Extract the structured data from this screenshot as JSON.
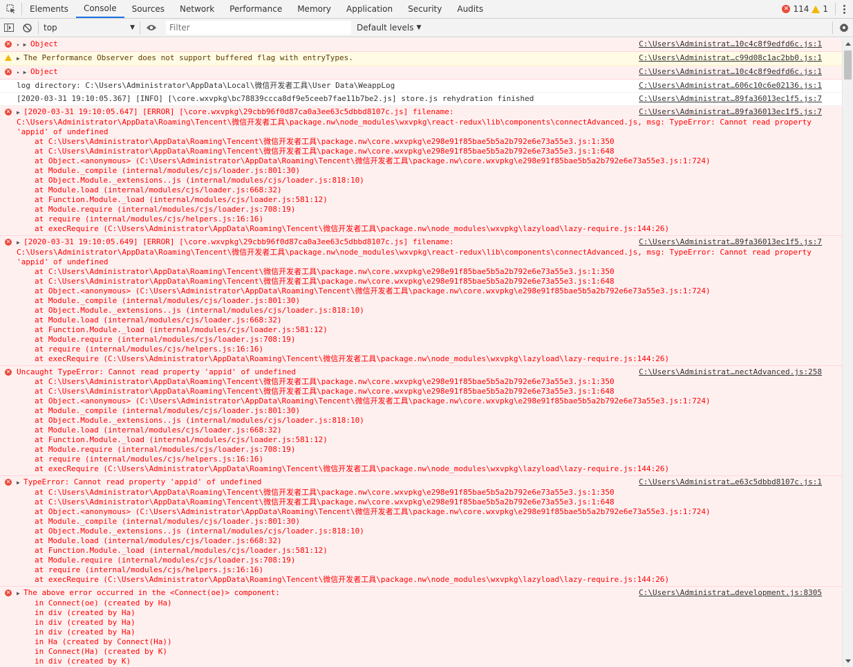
{
  "tabs": [
    "Elements",
    "Console",
    "Sources",
    "Network",
    "Performance",
    "Memory",
    "Application",
    "Security",
    "Audits"
  ],
  "active_tab": "Console",
  "counts": {
    "errors": "114",
    "warnings": "1"
  },
  "toolbar": {
    "context": "top",
    "filter_placeholder": "Filter",
    "levels": "Default levels"
  },
  "messages": [
    {
      "level": "error",
      "expander": "▸ ▶",
      "lines": [
        "Object"
      ],
      "source": "C:\\Users\\Administrat…10c4c8f9edfd6c.js:1"
    },
    {
      "level": "warning",
      "expander": "▶",
      "lines": [
        "The Performance Observer does not support buffered flag with entryTypes."
      ],
      "source": "C:\\Users\\Administrat…c99d08c1ac2bb0.js:1"
    },
    {
      "level": "error",
      "expander": "▸ ▶",
      "lines": [
        "Object"
      ],
      "source": "C:\\Users\\Administrat…10c4c8f9edfd6c.js:1"
    },
    {
      "level": "log",
      "expander": "",
      "lines": [
        "log directory: C:\\Users\\Administrator\\AppData\\Local\\微信开发者工具\\User Data\\WeappLog"
      ],
      "source": "C:\\Users\\Administrat…606c10c6e02136.js:1"
    },
    {
      "level": "log",
      "expander": "",
      "lines": [
        "[2020-03-31 19:10:05.367] [INFO] [\\core.wxvpkg\\bc78839ccca8df9e5ceeb7fae11b7be2.js] store.js rehydration finished"
      ],
      "source": "C:\\Users\\Administrat…89fa36013ec1f5.js:7"
    },
    {
      "level": "error",
      "expander": "▶",
      "lines": [
        "[2020-03-31 19:10:05.647] [ERROR] [\\core.wxvpkg\\29cbb96f0d87ca0a3ee63c5dbbd8107c.js] filename:",
        "C:\\Users\\Administrator\\AppData\\Roaming\\Tencent\\微信开发者工具\\package.nw\\node_modules\\wxvpkg\\react-redux\\lib\\components\\connectAdvanced.js, msg: TypeError: Cannot read property",
        "'appid' of undefined"
      ],
      "stack": [
        "at C:\\Users\\Administrator\\AppData\\Roaming\\Tencent\\微信开发者工具\\package.nw\\core.wxvpkg\\e298e91f85bae5b5a2b792e6e73a55e3.js:1:350",
        "at C:\\Users\\Administrator\\AppData\\Roaming\\Tencent\\微信开发者工具\\package.nw\\core.wxvpkg\\e298e91f85bae5b5a2b792e6e73a55e3.js:1:648",
        "at Object.<anonymous> (C:\\Users\\Administrator\\AppData\\Roaming\\Tencent\\微信开发者工具\\package.nw\\core.wxvpkg\\e298e91f85bae5b5a2b792e6e73a55e3.js:1:724)",
        "at Module._compile (internal/modules/cjs/loader.js:801:30)",
        "at Object.Module._extensions..js (internal/modules/cjs/loader.js:818:10)",
        "at Module.load (internal/modules/cjs/loader.js:668:32)",
        "at Function.Module._load (internal/modules/cjs/loader.js:581:12)",
        "at Module.require (internal/modules/cjs/loader.js:708:19)",
        "at require (internal/modules/cjs/helpers.js:16:16)",
        "at execRequire (C:\\Users\\Administrator\\AppData\\Roaming\\Tencent\\微信开发者工具\\package.nw\\node_modules\\wxvpkg\\lazyload\\lazy-require.js:144:26)"
      ],
      "source": "C:\\Users\\Administrat…89fa36013ec1f5.js:7"
    },
    {
      "level": "error",
      "expander": "▶",
      "lines": [
        "[2020-03-31 19:10:05.649] [ERROR] [\\core.wxvpkg\\29cbb96f0d87ca0a3ee63c5dbbd8107c.js] filename:",
        "C:\\Users\\Administrator\\AppData\\Roaming\\Tencent\\微信开发者工具\\package.nw\\node_modules\\wxvpkg\\react-redux\\lib\\components\\connectAdvanced.js, msg: TypeError: Cannot read property",
        "'appid' of undefined"
      ],
      "stack": [
        "at C:\\Users\\Administrator\\AppData\\Roaming\\Tencent\\微信开发者工具\\package.nw\\core.wxvpkg\\e298e91f85bae5b5a2b792e6e73a55e3.js:1:350",
        "at C:\\Users\\Administrator\\AppData\\Roaming\\Tencent\\微信开发者工具\\package.nw\\core.wxvpkg\\e298e91f85bae5b5a2b792e6e73a55e3.js:1:648",
        "at Object.<anonymous> (C:\\Users\\Administrator\\AppData\\Roaming\\Tencent\\微信开发者工具\\package.nw\\core.wxvpkg\\e298e91f85bae5b5a2b792e6e73a55e3.js:1:724)",
        "at Module._compile (internal/modules/cjs/loader.js:801:30)",
        "at Object.Module._extensions..js (internal/modules/cjs/loader.js:818:10)",
        "at Module.load (internal/modules/cjs/loader.js:668:32)",
        "at Function.Module._load (internal/modules/cjs/loader.js:581:12)",
        "at Module.require (internal/modules/cjs/loader.js:708:19)",
        "at require (internal/modules/cjs/helpers.js:16:16)",
        "at execRequire (C:\\Users\\Administrator\\AppData\\Roaming\\Tencent\\微信开发者工具\\package.nw\\node_modules\\wxvpkg\\lazyload\\lazy-require.js:144:26)"
      ],
      "source": "C:\\Users\\Administrat…89fa36013ec1f5.js:7"
    },
    {
      "level": "error",
      "expander": "",
      "lines": [
        "Uncaught TypeError: Cannot read property 'appid' of undefined"
      ],
      "stack": [
        "at C:\\Users\\Administrator\\AppData\\Roaming\\Tencent\\微信开发者工具\\package.nw\\core.wxvpkg\\e298e91f85bae5b5a2b792e6e73a55e3.js:1:350",
        "at C:\\Users\\Administrator\\AppData\\Roaming\\Tencent\\微信开发者工具\\package.nw\\core.wxvpkg\\e298e91f85bae5b5a2b792e6e73a55e3.js:1:648",
        "at Object.<anonymous> (C:\\Users\\Administrator\\AppData\\Roaming\\Tencent\\微信开发者工具\\package.nw\\core.wxvpkg\\e298e91f85bae5b5a2b792e6e73a55e3.js:1:724)",
        "at Module._compile (internal/modules/cjs/loader.js:801:30)",
        "at Object.Module._extensions..js (internal/modules/cjs/loader.js:818:10)",
        "at Module.load (internal/modules/cjs/loader.js:668:32)",
        "at Function.Module._load (internal/modules/cjs/loader.js:581:12)",
        "at Module.require (internal/modules/cjs/loader.js:708:19)",
        "at require (internal/modules/cjs/helpers.js:16:16)",
        "at execRequire (C:\\Users\\Administrator\\AppData\\Roaming\\Tencent\\微信开发者工具\\package.nw\\node_modules\\wxvpkg\\lazyload\\lazy-require.js:144:26)"
      ],
      "source": "C:\\Users\\Administrat…nectAdvanced.js:258"
    },
    {
      "level": "error",
      "expander": "▶",
      "lines": [
        "TypeError: Cannot read property 'appid' of undefined"
      ],
      "stack": [
        "at C:\\Users\\Administrator\\AppData\\Roaming\\Tencent\\微信开发者工具\\package.nw\\core.wxvpkg\\e298e91f85bae5b5a2b792e6e73a55e3.js:1:350",
        "at C:\\Users\\Administrator\\AppData\\Roaming\\Tencent\\微信开发者工具\\package.nw\\core.wxvpkg\\e298e91f85bae5b5a2b792e6e73a55e3.js:1:648",
        "at Object.<anonymous> (C:\\Users\\Administrator\\AppData\\Roaming\\Tencent\\微信开发者工具\\package.nw\\core.wxvpkg\\e298e91f85bae5b5a2b792e6e73a55e3.js:1:724)",
        "at Module._compile (internal/modules/cjs/loader.js:801:30)",
        "at Object.Module._extensions..js (internal/modules/cjs/loader.js:818:10)",
        "at Module.load (internal/modules/cjs/loader.js:668:32)",
        "at Function.Module._load (internal/modules/cjs/loader.js:581:12)",
        "at Module.require (internal/modules/cjs/loader.js:708:19)",
        "at require (internal/modules/cjs/helpers.js:16:16)",
        "at execRequire (C:\\Users\\Administrator\\AppData\\Roaming\\Tencent\\微信开发者工具\\package.nw\\node_modules\\wxvpkg\\lazyload\\lazy-require.js:144:26)"
      ],
      "source": "C:\\Users\\Administrat…e63c5dbbd8107c.js:1"
    },
    {
      "level": "error",
      "expander": "▶",
      "lines": [
        "The above error occurred in the <Connect(oe)> component:"
      ],
      "stack": [
        "in Connect(oe) (created by Ha)",
        "in div (created by Ha)",
        "in div (created by Ha)",
        "in div (created by Ha)",
        "in Ha (created by Connect(Ha))",
        "in Connect(Ha) (created by K)",
        "in div (created by K)"
      ],
      "source": "C:\\Users\\Administrat…development.js:8305"
    }
  ]
}
